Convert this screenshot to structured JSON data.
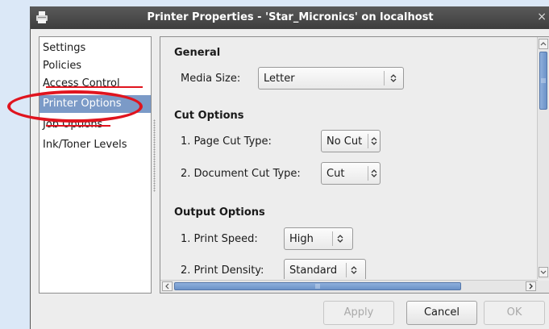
{
  "window": {
    "title": "Printer Properties - 'Star_Micronics' on localhost",
    "close_glyph": "×"
  },
  "sidebar": {
    "items": [
      {
        "label": "Settings"
      },
      {
        "label": "Policies"
      },
      {
        "label": "Access Control"
      },
      {
        "label": "Printer Options"
      },
      {
        "label": "Job Options"
      },
      {
        "label": "Ink/Toner Levels"
      }
    ],
    "selected_index": 3
  },
  "content": {
    "general": {
      "title": "General",
      "media_size_label": "Media Size:",
      "media_size_value": "Letter"
    },
    "cut_options": {
      "title": "Cut Options",
      "page_cut_label": "1. Page Cut Type:",
      "page_cut_value": "No Cut",
      "document_cut_label": "2. Document Cut Type:",
      "document_cut_value": "Cut"
    },
    "output_options": {
      "title": "Output Options",
      "print_speed_label": "1. Print Speed:",
      "print_speed_value": "High",
      "print_density_label": "2. Print Density:",
      "print_density_value": "Standard"
    }
  },
  "buttons": {
    "apply": "Apply",
    "cancel": "Cancel",
    "ok": "OK"
  },
  "colors": {
    "selection": "#7b9ac7",
    "annotation": "#e0141e",
    "titlebar": "#3d3d3d"
  }
}
